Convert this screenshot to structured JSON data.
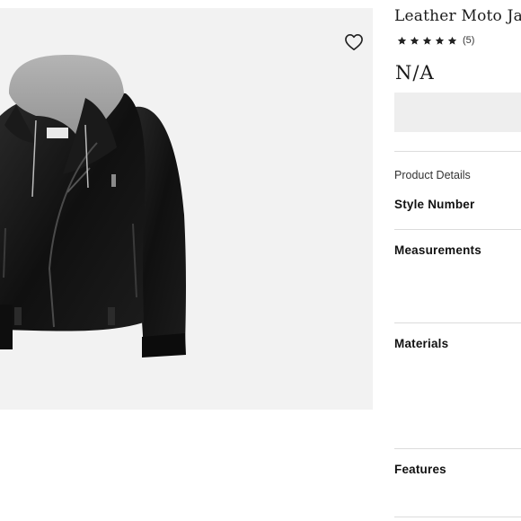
{
  "product": {
    "title": "Leather Moto Jacket",
    "rating_stars": 5,
    "rating_count": "(5)",
    "price": "N/A",
    "wishlist_icon": "heart-outline-icon"
  },
  "details": {
    "heading": "Product Details",
    "sections": [
      "Style Number",
      "Measurements",
      "Materials",
      "Features"
    ]
  },
  "colors": {
    "image_background": "#f2f2f2",
    "action_box": "#eeeeee",
    "divider": "#dcdcdc",
    "jacket_leather": "#141414",
    "hood_gray": "#9a9a9a"
  }
}
